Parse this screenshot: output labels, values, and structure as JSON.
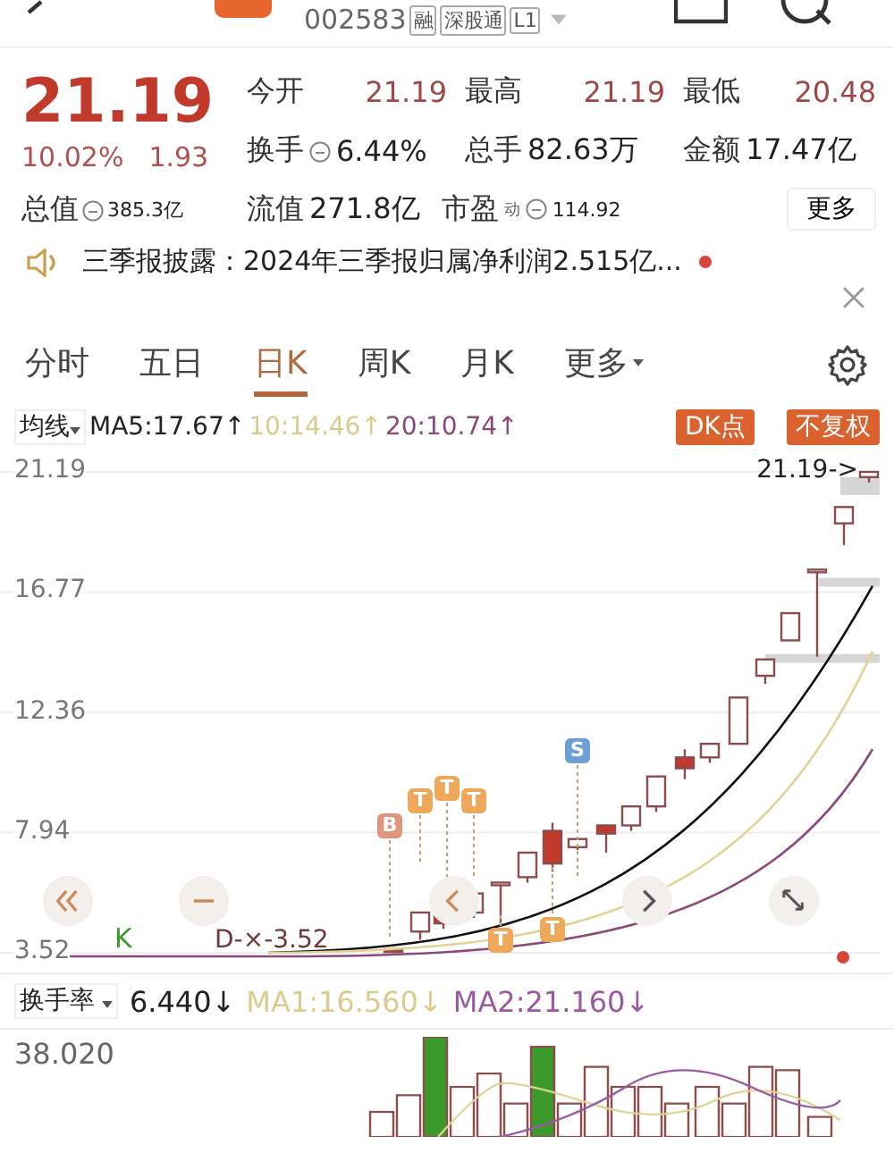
{
  "header": {
    "code": "002583",
    "badges": [
      "融",
      "深股通",
      "L1"
    ]
  },
  "quote": {
    "price": "21.19",
    "change_pct": "10.02%",
    "change": "1.93",
    "stats": [
      {
        "label": "今开",
        "value": "21.19",
        "kind": "price",
        "info": false
      },
      {
        "label": "最高",
        "value": "21.19",
        "kind": "price",
        "info": false
      },
      {
        "label": "最低",
        "value": "20.48",
        "kind": "price",
        "info": false
      },
      {
        "label": "换手",
        "value": "6.44%",
        "kind": "plain",
        "info": true
      },
      {
        "label": "总手",
        "value": "82.63万",
        "kind": "plain",
        "info": false
      },
      {
        "label": "金额",
        "value": "17.47亿",
        "kind": "plain",
        "info": false
      }
    ],
    "total_value": {
      "label": "总值",
      "value": "385.3亿"
    },
    "row3": [
      {
        "label": "流值",
        "value": "271.8亿",
        "info": false
      },
      {
        "label": "市盈",
        "sup": "动",
        "value": "114.92",
        "info": true
      }
    ],
    "more": "更多"
  },
  "notice": {
    "text": "三季报披露：2024年三季报归属净利润2.515亿...",
    "unread": true
  },
  "tabs": [
    {
      "label": "分时",
      "selected": false
    },
    {
      "label": "五日",
      "selected": false
    },
    {
      "label": "日K",
      "selected": true
    },
    {
      "label": "周K",
      "selected": false
    },
    {
      "label": "月K",
      "selected": false
    }
  ],
  "more_tab": "更多",
  "ma_bar": {
    "selector": "均线",
    "items": [
      {
        "text": "MA5:17.67↑",
        "color": "#222222"
      },
      {
        "text": "10:14.46↑",
        "color": "#d9cc8c"
      },
      {
        "text": "20:10.74↑",
        "color": "#8a4a7a"
      }
    ],
    "buttons": [
      "DK点",
      "不复权"
    ]
  },
  "chart": {
    "y_labels": [
      "21.19",
      "16.77",
      "12.36",
      "7.94",
      "3.52"
    ],
    "last_price": "21.19->",
    "markers": [
      {
        "label": "B",
        "color": "#e0957f"
      },
      {
        "label": "T",
        "color": "#eda85a"
      },
      {
        "label": "T",
        "color": "#eda85a"
      },
      {
        "label": "T",
        "color": "#eda85a"
      },
      {
        "label": "S",
        "color": "#6d9fd6"
      },
      {
        "label": "T",
        "color": "#eda85a"
      },
      {
        "label": "T",
        "color": "#eda85a"
      }
    ],
    "k_label": "K",
    "d_label": "D-×-3.52"
  },
  "indicator": {
    "selector": "换手率",
    "items": [
      {
        "text": "6.440↓",
        "color": "#222222"
      },
      {
        "text": "MA1:16.560↓",
        "color": "#d9cc8c"
      },
      {
        "text": "MA2:21.160↓",
        "color": "#9a5aa0"
      }
    ],
    "y_label": "38.020"
  }
}
